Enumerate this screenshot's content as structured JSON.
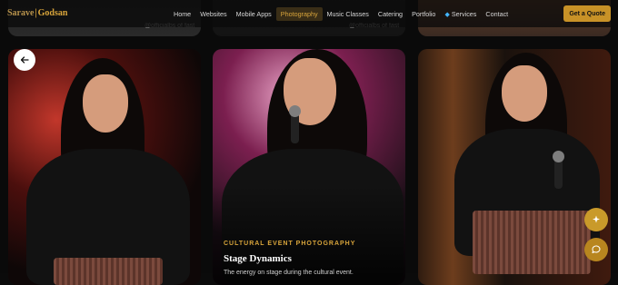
{
  "nav": {
    "logo_part1": "Sarave",
    "logo_part2": "Godsan",
    "items": [
      {
        "label": "Home",
        "active": false
      },
      {
        "label": "Websites",
        "active": false
      },
      {
        "label": "Mobile Apps",
        "active": false
      },
      {
        "label": "Photography",
        "active": true
      },
      {
        "label": "Music Classes",
        "active": false
      },
      {
        "label": "Catering",
        "active": false
      },
      {
        "label": "Portfolio",
        "active": false
      },
      {
        "label": "Services",
        "active": false
      },
      {
        "label": "Contact",
        "active": false
      }
    ],
    "cta": "Get a Quote"
  },
  "top_cards": [
    {
      "handle": "@officialbs of fast"
    },
    {
      "handle": "@officialbs of fast"
    },
    {
      "handle": ""
    }
  ],
  "featured": {
    "category": "CULTURAL EVENT PHOTOGRAPHY",
    "title": "Stage Dynamics",
    "description": "The energy on stage during the cultural event."
  },
  "icons": {
    "back": "arrow-left-icon",
    "sparkle": "sparkle-icon",
    "chat": "chat-bubble-icon",
    "gem": "gem-icon"
  },
  "colors": {
    "accent": "#d9a53b",
    "cta_bg": "#c89227",
    "nav_bg": "#0a0a0a"
  }
}
